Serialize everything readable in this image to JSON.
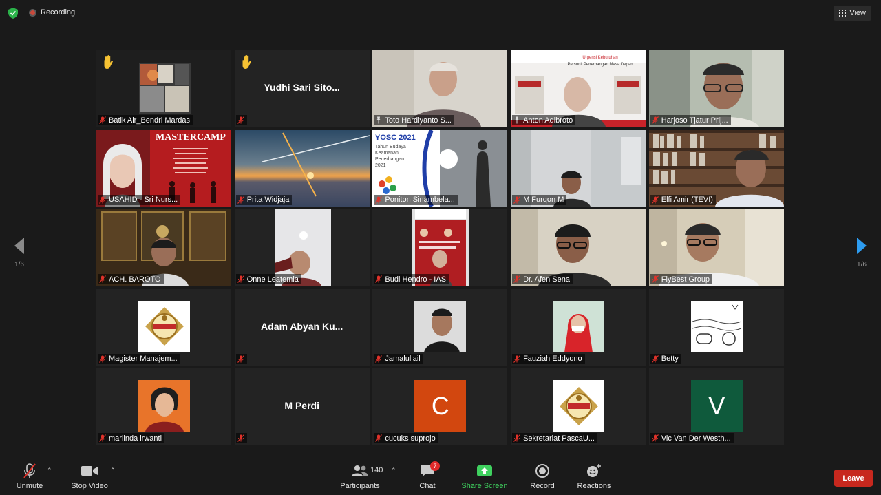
{
  "topbar": {
    "recording_label": "Recording",
    "view_label": "View"
  },
  "nav": {
    "left_page": "1/6",
    "right_page": "1/6"
  },
  "participants": [
    {
      "name": "Batik Air_Bendri Mardas",
      "hand": true,
      "active": true,
      "kind": "video",
      "scene": "collage"
    },
    {
      "name": "Yudhi Sari Sito...",
      "hand": true,
      "kind": "name"
    },
    {
      "name": "Toto Hardiyanto S...",
      "kind": "video",
      "scene": "man-white",
      "pinned": true
    },
    {
      "name": "Anton Adibroto",
      "kind": "video",
      "scene": "poster-man",
      "pinned": true
    },
    {
      "name": "Harjoso Tjatur Prij...",
      "kind": "video",
      "scene": "man-glasses"
    },
    {
      "name": "USAHID - Sri Nurs...",
      "kind": "video",
      "scene": "mastercamp",
      "overlay_title": "MASTERCAMP"
    },
    {
      "name": "Prita Widjaja",
      "kind": "video",
      "scene": "sunset"
    },
    {
      "name": "Poniton Sinambela...",
      "kind": "video",
      "scene": "yosc",
      "overlay_title": "YOSC 2021",
      "overlay_lines": [
        "Tahun Budaya",
        "Keamanan",
        "Penerbangan",
        "2021"
      ]
    },
    {
      "name": "M Furqon M",
      "kind": "video",
      "scene": "room-man"
    },
    {
      "name": "Elfi Amir (TEVI)",
      "kind": "video",
      "scene": "bookshelf"
    },
    {
      "name": "ACH. BAROTO",
      "kind": "video",
      "scene": "cabinet"
    },
    {
      "name": "Onne Leatemia",
      "kind": "video",
      "scene": "ceiling-light"
    },
    {
      "name": "Budi Hendro - IAS",
      "kind": "video",
      "scene": "red-poster"
    },
    {
      "name": "Dr. Afen Sena",
      "kind": "video",
      "scene": "man-dark"
    },
    {
      "name": "FlyBest Group",
      "kind": "video",
      "scene": "man-office"
    },
    {
      "name": "Magister Manajem...",
      "kind": "avatar",
      "scene": "logo"
    },
    {
      "name": "Adam Abyan Ku...",
      "kind": "name"
    },
    {
      "name": "Jamalullail",
      "kind": "avatar",
      "scene": "portrait-man"
    },
    {
      "name": "Fauziah Eddyono",
      "kind": "avatar",
      "scene": "portrait-red"
    },
    {
      "name": "Betty",
      "kind": "avatar",
      "scene": "sketch"
    },
    {
      "name": "marlinda irwanti",
      "kind": "avatar",
      "scene": "portrait-woman"
    },
    {
      "name": "M Perdi",
      "kind": "name"
    },
    {
      "name": "cucuks suprojo",
      "kind": "letter",
      "letter": "C",
      "color": "#d2470f"
    },
    {
      "name": "Sekretariat PascaU...",
      "kind": "avatar",
      "scene": "logo"
    },
    {
      "name": "Vic Van Der Westh...",
      "kind": "letter",
      "letter": "V",
      "color": "#0f5a3c"
    }
  ],
  "toolbar": {
    "unmute": "Unmute",
    "stop_video": "Stop Video",
    "participants": "Participants",
    "participant_count": "140",
    "chat": "Chat",
    "chat_badge": "7",
    "share_screen": "Share Screen",
    "record": "Record",
    "reactions": "Reactions",
    "leave": "Leave"
  },
  "colors": {
    "background": "#1a1a1a",
    "tile": "#232323",
    "active_border": "#d8e04a",
    "share_green": "#3fd15f",
    "leave_red": "#c7281e"
  }
}
